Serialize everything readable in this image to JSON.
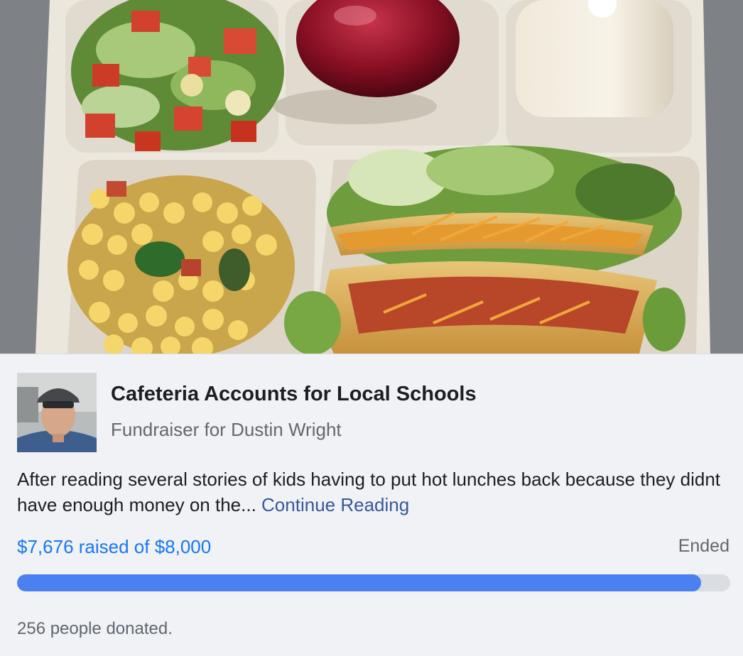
{
  "fundraiser": {
    "title": "Cafeteria Accounts for Local Schools",
    "subtitle": "Fundraiser for Dustin Wright",
    "description": "After reading several stories of kids having to put hot lunches back because they didnt have enough money on the... ",
    "continue_label": "Continue Reading",
    "raised_text": "$7,676 raised of $8,000",
    "raised_amount": 7676,
    "goal_amount": 8000,
    "progress_fraction": 0.9595,
    "status": "Ended",
    "donors_text": "256 people donated."
  },
  "colors": {
    "accent": "#1877f2",
    "progress_fill": "#4a80f0",
    "link": "#385898",
    "background": "#f0f2f5"
  },
  "images": {
    "hero": "school-lunch-tray-photo",
    "avatar": "organizer-avatar-photo"
  }
}
